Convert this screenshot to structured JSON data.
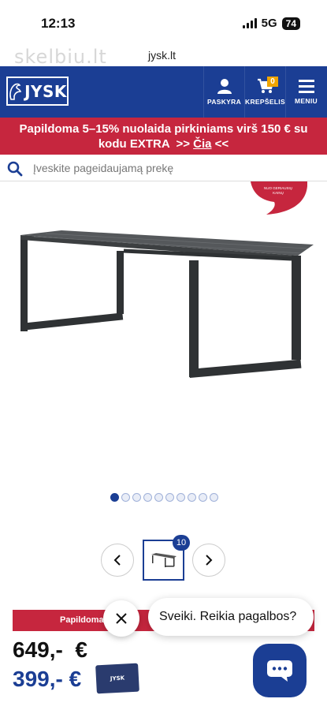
{
  "status": {
    "time": "12:13",
    "network": "5G",
    "battery": "74"
  },
  "browser": {
    "watermark": "skelbiu.lt",
    "url": "jysk.lt"
  },
  "header": {
    "logo_text": "JYSK",
    "nav": [
      {
        "label": "PASKYRA"
      },
      {
        "label": "KREPŠELIS",
        "badge": "0"
      },
      {
        "label": "MENIU"
      }
    ]
  },
  "promo": {
    "line1": "Papildoma 5–15% nuolaida pirkiniams virš 150 € su",
    "line2_start": "kodu EXTRA  >> ",
    "link": "Čia",
    "line2_end": " <<"
  },
  "search": {
    "placeholder": "Įveskite pageidaujamą prekę"
  },
  "badge": {
    "text": "NUO GERIAUSIŲ\nKAINŲ"
  },
  "gallery": {
    "dot_count": 10,
    "active_index": 0,
    "thumb_count": "10"
  },
  "price_strip": {
    "text": "Papildoma"
  },
  "prices": {
    "old": "649,-  €",
    "new": "399,- €"
  },
  "card": {
    "label": "JYSK"
  },
  "chat": {
    "message": "Sveiki. Reikia pagalbos?"
  },
  "colors": {
    "brand_blue": "#1b3e94",
    "promo_red": "#c6263e",
    "cart_badge": "#f0a500"
  }
}
